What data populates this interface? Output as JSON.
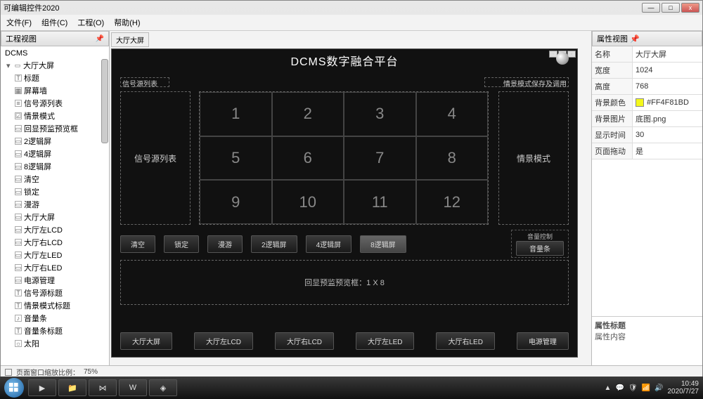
{
  "window": {
    "title": "可编辑控件2020",
    "min": "—",
    "max": "□",
    "close": "x"
  },
  "menu": {
    "file": "文件(F)",
    "component": "组件(C)",
    "project": "工程(O)",
    "help": "帮助(H)"
  },
  "leftPanel": {
    "title": "工程视图",
    "root": "DCMS",
    "node1": "大厅大屏",
    "children": [
      {
        "icon": "T",
        "label": "标题"
      },
      {
        "icon": "▦",
        "label": "屏幕墙"
      },
      {
        "icon": "≡",
        "label": "信号源列表"
      },
      {
        "icon": "☑",
        "label": "情景模式"
      },
      {
        "icon": "▭",
        "label": "回显预监预览框"
      },
      {
        "icon": "▭",
        "label": "2逻辑屏"
      },
      {
        "icon": "▭",
        "label": "4逻辑屏"
      },
      {
        "icon": "▭",
        "label": "8逻辑屏"
      },
      {
        "icon": "▭",
        "label": "清空"
      },
      {
        "icon": "▭",
        "label": "锁定"
      },
      {
        "icon": "▭",
        "label": "漫游"
      },
      {
        "icon": "▭",
        "label": "大厅大屏"
      },
      {
        "icon": "▭",
        "label": "大厅左LCD"
      },
      {
        "icon": "▭",
        "label": "大厅右LCD"
      },
      {
        "icon": "▭",
        "label": "大厅左LED"
      },
      {
        "icon": "▭",
        "label": "大厅右LED"
      },
      {
        "icon": "▭",
        "label": "电源管理"
      },
      {
        "icon": "T",
        "label": "信号源标题"
      },
      {
        "icon": "T",
        "label": "情景模式标题"
      },
      {
        "icon": "♪",
        "label": "音量条"
      },
      {
        "icon": "T",
        "label": "音量条标题"
      },
      {
        "icon": "☼",
        "label": "太阳"
      }
    ]
  },
  "canvas": {
    "tab": "大厅大屏",
    "title": "DCMS数字融合平台",
    "sigListHeader": "信号源列表",
    "sceneSaveHeader": "情景模式保存及调用",
    "leftBox": "信号源列表",
    "rightBox": "情景模式",
    "cells": [
      "1",
      "2",
      "3",
      "4",
      "5",
      "6",
      "7",
      "8",
      "9",
      "10",
      "11",
      "12"
    ],
    "btns": [
      "清空",
      "锁定",
      "漫游",
      "2逻辑屏",
      "4逻辑屏",
      "8逻辑屏"
    ],
    "volTitle": "音量控制",
    "volBar": "音量条",
    "preview": "回显预监预览框：1 X 8",
    "bottomBtns": [
      "大厅大屏",
      "大厅左LCD",
      "大厅右LCD",
      "大厅左LED",
      "大厅右LED",
      "电源管理"
    ]
  },
  "props": {
    "title": "属性视图",
    "rows": [
      {
        "k": "名称",
        "v": "大厅大屏"
      },
      {
        "k": "宽度",
        "v": "1024"
      },
      {
        "k": "高度",
        "v": "768"
      },
      {
        "k": "背景颜色",
        "v": "#FF4F81BD",
        "swatch": true
      },
      {
        "k": "背景图片",
        "v": "底图.png"
      },
      {
        "k": "显示时间",
        "v": "30"
      },
      {
        "k": "页面拖动",
        "v": "是"
      }
    ],
    "detailTitle": "属性标题",
    "detailBody": "属性内容"
  },
  "status": {
    "zoom": "页面窗口缩放比例：",
    "zoomVal": "75%"
  },
  "taskbar": {
    "time": "10:49",
    "date": "2020/7/27"
  }
}
